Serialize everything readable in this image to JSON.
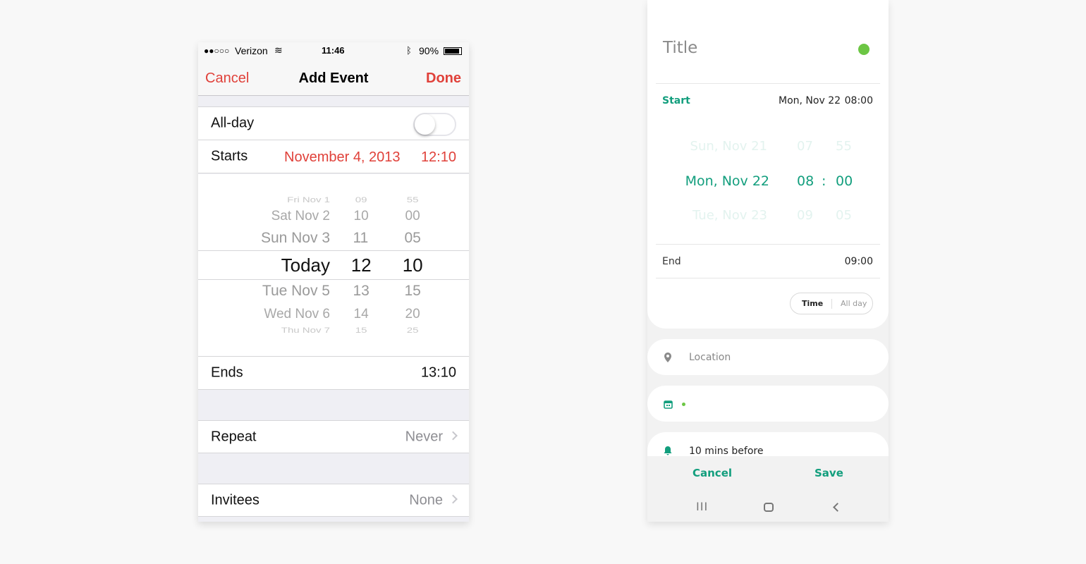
{
  "ios": {
    "status": {
      "signal": "●●○○○",
      "carrier": "Verizon",
      "time": "11:46",
      "battery": "90%"
    },
    "nav": {
      "cancel": "Cancel",
      "title": "Add Event",
      "done": "Done"
    },
    "allday": {
      "label": "All-day",
      "on": false
    },
    "starts": {
      "label": "Starts",
      "date": "November 4, 2013",
      "time": "12:10"
    },
    "picker": {
      "rows": [
        {
          "d": "Fri Nov 1",
          "h": "09",
          "m": "55"
        },
        {
          "d": "Sat Nov 2",
          "h": "10",
          "m": "00"
        },
        {
          "d": "Sun Nov 3",
          "h": "11",
          "m": "05"
        },
        {
          "d": "Today",
          "h": "12",
          "m": "10"
        },
        {
          "d": "Tue Nov 5",
          "h": "13",
          "m": "15"
        },
        {
          "d": "Wed Nov 6",
          "h": "14",
          "m": "20"
        },
        {
          "d": "Thu Nov 7",
          "h": "15",
          "m": "25"
        }
      ]
    },
    "ends": {
      "label": "Ends",
      "value": "13:10"
    },
    "repeat": {
      "label": "Repeat",
      "value": "Never"
    },
    "invitees": {
      "label": "Invitees",
      "value": "None"
    },
    "accent": "#e0413a"
  },
  "android": {
    "title_placeholder": "Title",
    "color_dot": "#6cc644",
    "start": {
      "label": "Start",
      "date": "Mon, Nov 22",
      "time": "08:00"
    },
    "picker": {
      "prev": {
        "d": "Sun, Nov 21",
        "h": "07",
        "m": "55"
      },
      "cur": {
        "d": "Mon, Nov 22",
        "h": "08",
        "sep": ":",
        "m": "00"
      },
      "next": {
        "d": "Tue, Nov 23",
        "h": "09",
        "m": "05"
      }
    },
    "end": {
      "label": "End",
      "time": "09:00"
    },
    "mode": {
      "time": "Time",
      "allday": "All day",
      "selected": "Time"
    },
    "location_placeholder": "Location",
    "reminder": "10 mins before",
    "cancel": "Cancel",
    "save": "Save",
    "accent": "#129e7d"
  }
}
